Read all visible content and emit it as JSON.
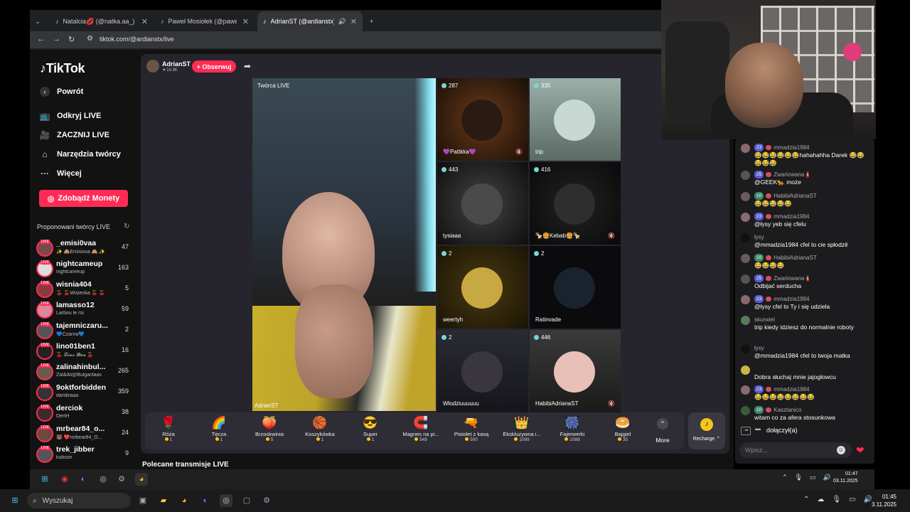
{
  "browser": {
    "tabs": [
      {
        "label": "Natalcia💋 (@natka.aa_) prowadzi",
        "active": false
      },
      {
        "label": "Paweł Mosiołek (@pawelmosio)",
        "active": false
      },
      {
        "label": "AdrianST (@ardianstx) prowadzi",
        "active": true
      }
    ],
    "url": "tiktok.com/@ardianstx/live"
  },
  "sidebar": {
    "logo": "TikTok",
    "menu": [
      {
        "label": "Powrót",
        "icon": "arrow-left-icon"
      },
      {
        "label": "Odkryj LIVE",
        "icon": "tv-icon"
      },
      {
        "label": "ZACZNIJ LIVE",
        "icon": "camera-icon"
      },
      {
        "label": "Narzędzia twórcy",
        "icon": "home-tools-icon"
      },
      {
        "label": "Więcej",
        "icon": "more-dots-icon"
      }
    ],
    "coins_button": "Zdobądź Monety",
    "suggested_title": "Proponowani twórcy LIVE",
    "live_badge": "LIVE",
    "creators": [
      {
        "name": "_emisi0vaa",
        "sub": "✨ 🙈Emisiova 🙈 ✨",
        "count": "47"
      },
      {
        "name": "nightcameup",
        "sub": "nightcameup",
        "count": "163"
      },
      {
        "name": "wisnia404",
        "sub": "🍒 🍒Wisienka 🍒 🍒",
        "count": "5"
      },
      {
        "name": "lamasso12",
        "sub": "Larbou le roi",
        "count": "59"
      },
      {
        "name": "tajemniczaru...",
        "sub": "💙Czarna💙",
        "count": "2"
      },
      {
        "name": "lino01ben1",
        "sub": "🍒 𝓛𝓲𝓷𝓸 𝓑𝓮𝓷 🍒",
        "count": "16"
      },
      {
        "name": "zalinahinbul...",
        "sub": "Zal&Ali@Bulgarilaas",
        "count": "265"
      },
      {
        "name": "9oktforbidden",
        "sub": "daridiraaa",
        "count": "359"
      },
      {
        "name": "derciok",
        "sub": "DertH",
        "count": "38"
      },
      {
        "name": "mrbear84_o...",
        "sub": "🐻 ❤️mrbear84_O...",
        "count": "24"
      },
      {
        "name": "trek_jibber",
        "sub": "kubson",
        "count": "9"
      }
    ]
  },
  "live": {
    "host_name": "AdrianST",
    "host_likes": "19.9K",
    "follow_label": "+ Obserwuj",
    "stage_label": "Twórca LIVE",
    "stage_name": "AdrianST",
    "guests": [
      {
        "count": "287",
        "name": "💜Pattkka💜",
        "muted": true
      },
      {
        "count": "335",
        "name": "trip",
        "muted": false
      },
      {
        "count": "443",
        "name": "tysiaaa",
        "muted": false
      },
      {
        "count": "416",
        "name": "🍢🍔Kebab🍔🍢",
        "muted": true
      },
      {
        "count": "2",
        "name": "weertyh",
        "muted": false
      },
      {
        "count": "2",
        "name": "Ratinvade",
        "muted": false
      },
      {
        "count": "2",
        "name": "Włodziuuuuuu",
        "muted": false
      },
      {
        "count": "446",
        "name": "HabibiAdrianaST",
        "muted": true
      }
    ],
    "gifts": [
      {
        "name": "Róża",
        "icon": "🌹",
        "price": "1"
      },
      {
        "name": "Tęcza",
        "icon": "🌈",
        "price": "1"
      },
      {
        "name": "Brzoskwinia",
        "icon": "🍑",
        "price": "5"
      },
      {
        "name": "Koszykówka",
        "icon": "🏀",
        "price": "1"
      },
      {
        "name": "Super",
        "icon": "😎",
        "price": "1"
      },
      {
        "name": "Magnes na pi...",
        "icon": "🧲",
        "price": "549"
      },
      {
        "name": "Pistolet z kasą",
        "icon": "🔫",
        "price": "500"
      },
      {
        "name": "Ekskluzywna i...",
        "icon": "👑",
        "price": "1099"
      },
      {
        "name": "Fajerwerki",
        "icon": "🎆",
        "price": "1088"
      },
      {
        "name": "Bajgiel",
        "icon": "🥯",
        "price": "35"
      }
    ],
    "more_label": "More",
    "recharge_label": "Recharge ⌃",
    "related_title": "Polecane transmisje LIVE"
  },
  "chat": {
    "messages": [
      {
        "user": "mmadzia1984",
        "level": "23",
        "text": "😂😂😂😂😂😂hahahahha Darek 😂😂😂😂😂"
      },
      {
        "user": "Zwariowana🧯",
        "level": "25",
        "text": "@GEEK🐆 może"
      },
      {
        "user": "HabibiAdrianaST",
        "level": "10",
        "text": "😂😂😂😂😂"
      },
      {
        "user": "mmadzia1984",
        "level": "23",
        "text": "@łysy yeb się cfelu"
      },
      {
        "user": "łysy",
        "level": "",
        "text": "@mmadzia1984 cfel to cie spłodził"
      },
      {
        "user": "HabibiAdrianaST",
        "level": "10",
        "text": "😂😂😂😂"
      },
      {
        "user": "Zwariowana🧯",
        "level": "25",
        "text": "Odbijać serducha"
      },
      {
        "user": "mmadzia1984",
        "level": "23",
        "text": "@łysy cfel to Ty i się udziela"
      },
      {
        "user": "skurwiel",
        "level": "",
        "text": "trip kiedy idziesz do normalnie roboty"
      },
      {
        "user": "łysy",
        "level": "",
        "text": "@mmadzia1984 cfel to twoja matka"
      },
      {
        "user": "",
        "level": "",
        "text": "Dobra słuchaj mnie jajogłowcu"
      },
      {
        "user": "mmadzia1984",
        "level": "23",
        "text": "😂😂😂😂😂😂😂😂"
      },
      {
        "user": "Kasztanico",
        "level": "10",
        "text": "witam co za afera stosunkowa"
      }
    ],
    "joined": "dołączył(a)",
    "input_placeholder": "Wpisz..."
  },
  "taskbar": {
    "search_label": "Wyszukaj",
    "inner_time": "01:47",
    "inner_date": "03.11.2025",
    "time": "01:45",
    "date": "3.11.2025"
  }
}
